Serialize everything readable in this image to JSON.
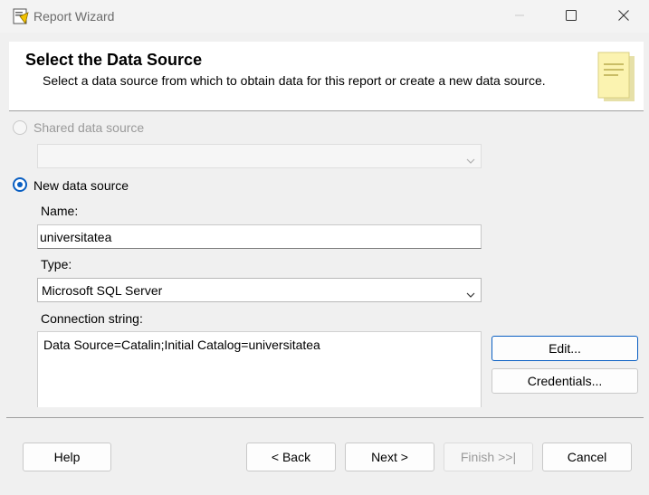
{
  "window": {
    "title": "Report Wizard"
  },
  "header": {
    "title": "Select the Data Source",
    "description": "Select a data source from which to obtain data for this report or create a new data source."
  },
  "shared_source": {
    "label": "Shared data source",
    "selected": false,
    "enabled": false,
    "value": ""
  },
  "new_source": {
    "label": "New data source",
    "selected": true
  },
  "name": {
    "label": "Name:",
    "value": "universitatea"
  },
  "type": {
    "label": "Type:",
    "value": "Microsoft SQL Server"
  },
  "connection": {
    "label": "Connection string:",
    "value": "Data Source=Catalin;Initial Catalog=universitatea",
    "edit_label": "Edit...",
    "credentials_label": "Credentials..."
  },
  "footer": {
    "help_label": "Help",
    "back_label": "< Back",
    "next_label": "Next >",
    "finish_label": "Finish >>|",
    "cancel_label": "Cancel"
  },
  "colors": {
    "accent": "#0a5fc2",
    "background": "#f0f0f0"
  }
}
